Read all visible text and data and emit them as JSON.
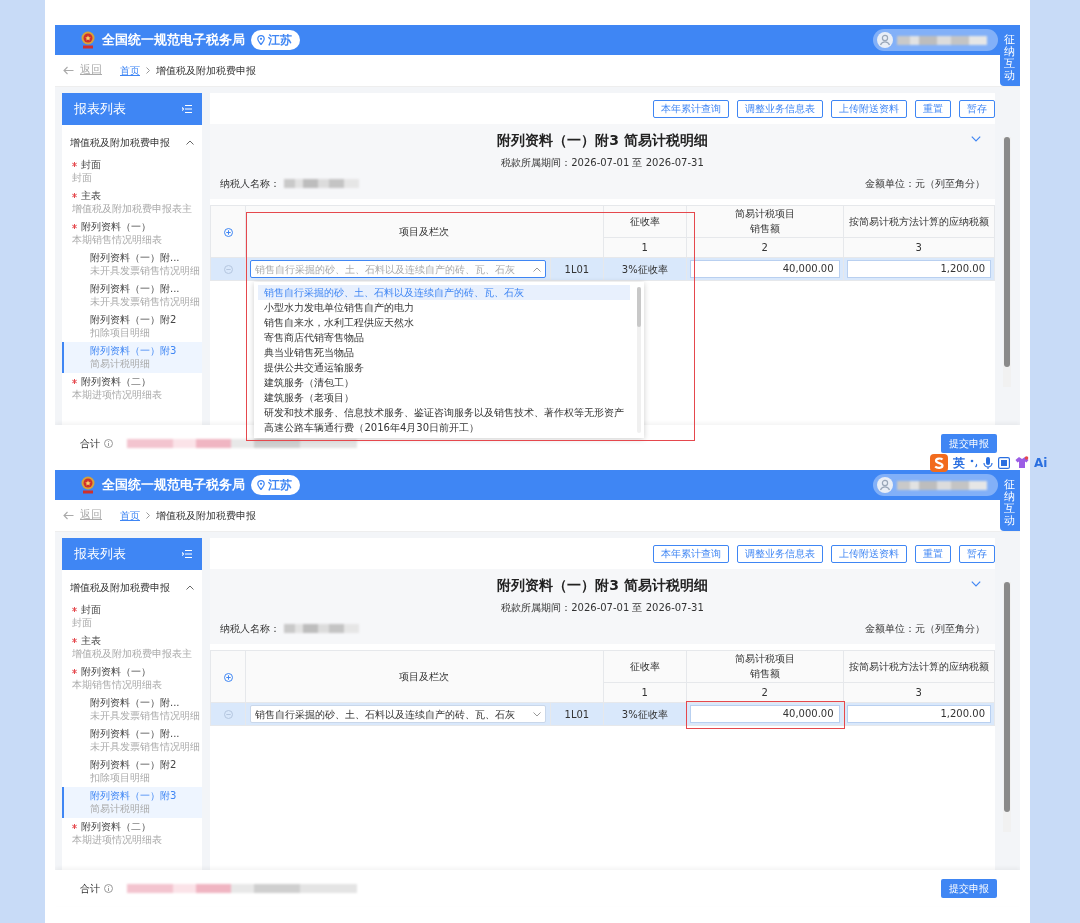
{
  "screens": [
    {
      "header": {
        "title": "全国统一规范电子税务局",
        "region": "江苏"
      },
      "side_tab": "征纳互动",
      "breadcrumb": {
        "back": "返回",
        "home": "首页",
        "current": "增值税及附加税费申报"
      },
      "sidebar": {
        "title": "报表列表",
        "group": {
          "label": "增值税及附加税费申报",
          "expanded": true,
          "items": [
            {
              "title": "封面",
              "subtitle": "封面",
              "required": true,
              "selected": false
            },
            {
              "title": "主表",
              "subtitle": "增值税及附加税费申报表主",
              "required": true,
              "selected": false
            },
            {
              "title": "附列资料（一）",
              "subtitle": "本期销售情况明细表",
              "required": true,
              "selected": false,
              "children": [
                {
                  "title": "附列资料（一）附...",
                  "subtitle": "未开具发票销售情况明细",
                  "required": false,
                  "selected": false
                },
                {
                  "title": "附列资料（一）附...",
                  "subtitle": "未开具发票销售情况明细",
                  "required": false,
                  "selected": false
                },
                {
                  "title": "附列资料（一）附2",
                  "subtitle": "扣除项目明细",
                  "required": false,
                  "selected": false
                },
                {
                  "title": "附列资料（一）附3",
                  "subtitle": "简易计税明细",
                  "required": false,
                  "selected": true
                }
              ]
            },
            {
              "title": "附列资料（二）",
              "subtitle": "本期进项情况明细表",
              "required": true,
              "selected": false
            }
          ]
        }
      },
      "toolbar": [
        "本年累计查询",
        "调整业务信息表",
        "上传附送资料",
        "重置",
        "暂存"
      ],
      "form": {
        "title": "附列资料（一）附3 简易计税明细",
        "period": "税款所属期间：2026-07-01 至 2026-07-31",
        "taxpayer_label": "纳税人名称：",
        "unit": "金额单位：元（列至角分）"
      },
      "table": {
        "columns": [
          {
            "label_lines": [
              "项目及栏次"
            ]
          },
          {
            "label_lines": [
              "征收率"
            ],
            "number": "1"
          },
          {
            "label_lines": [
              "简易计税项目",
              "销售额"
            ],
            "number": "2"
          },
          {
            "label_lines": [
              "按简易计税方法计算的应纳税额"
            ],
            "number": "3"
          }
        ],
        "rows": [
          {
            "item": {
              "placeholder": "销售自行采掘的砂、土、石料以及连续自产的砖、瓦、石灰",
              "expanded": true,
              "highlighted": true,
              "options": [
                {
                  "label": "销售自行采掘的砂、土、石料以及连续自产的砖、瓦、石灰",
                  "selected": true
                },
                {
                  "label": "小型水力发电单位销售自产的电力",
                  "selected": false
                },
                {
                  "label": "销售自来水，水利工程供应天然水",
                  "selected": false
                },
                {
                  "label": "寄售商店代销寄售物品",
                  "selected": false
                },
                {
                  "label": "典当业销售死当物品",
                  "selected": false
                },
                {
                  "label": "提供公共交通运输服务",
                  "selected": false
                },
                {
                  "label": "建筑服务（清包工）",
                  "selected": false
                },
                {
                  "label": "建筑服务（老项目）",
                  "selected": false
                },
                {
                  "label": "研发和技术服务、信息技术服务、鉴证咨询服务以及销售技术、著作权等无形资产",
                  "selected": false
                },
                {
                  "label": "高速公路车辆通行费（2016年4月30日前开工）",
                  "selected": false
                }
              ]
            },
            "code": "1L01",
            "rate": "3%征收率",
            "sales": {
              "value": "40,000.00",
              "highlighted": false
            },
            "tax": "1,200.00"
          }
        ]
      },
      "footer": {
        "total_label": "合计",
        "submit": "提交申报"
      },
      "ime_toolbar": {
        "language": "英",
        "assistant": "Ai"
      }
    },
    {
      "header": {
        "title": "全国统一规范电子税务局",
        "region": "江苏"
      },
      "side_tab": "征纳互动",
      "breadcrumb": {
        "back": "返回",
        "home": "首页",
        "current": "增值税及附加税费申报"
      },
      "sidebar": {
        "title": "报表列表",
        "group": {
          "label": "增值税及附加税费申报",
          "expanded": true,
          "items": [
            {
              "title": "封面",
              "subtitle": "封面",
              "required": true,
              "selected": false
            },
            {
              "title": "主表",
              "subtitle": "增值税及附加税费申报表主",
              "required": true,
              "selected": false
            },
            {
              "title": "附列资料（一）",
              "subtitle": "本期销售情况明细表",
              "required": true,
              "selected": false,
              "children": [
                {
                  "title": "附列资料（一）附...",
                  "subtitle": "未开具发票销售情况明细",
                  "required": false,
                  "selected": false
                },
                {
                  "title": "附列资料（一）附...",
                  "subtitle": "未开具发票销售情况明细",
                  "required": false,
                  "selected": false
                },
                {
                  "title": "附列资料（一）附2",
                  "subtitle": "扣除项目明细",
                  "required": false,
                  "selected": false
                },
                {
                  "title": "附列资料（一）附3",
                  "subtitle": "简易计税明细",
                  "required": false,
                  "selected": true
                }
              ]
            },
            {
              "title": "附列资料（二）",
              "subtitle": "本期进项情况明细表",
              "required": true,
              "selected": false
            }
          ]
        }
      },
      "toolbar": [
        "本年累计查询",
        "调整业务信息表",
        "上传附送资料",
        "重置",
        "暂存"
      ],
      "form": {
        "title": "附列资料（一）附3 简易计税明细",
        "period": "税款所属期间：2026-07-01 至 2026-07-31",
        "taxpayer_label": "纳税人名称：",
        "unit": "金额单位：元（列至角分）"
      },
      "table": {
        "columns": [
          {
            "label_lines": [
              "项目及栏次"
            ]
          },
          {
            "label_lines": [
              "征收率"
            ],
            "number": "1"
          },
          {
            "label_lines": [
              "简易计税项目",
              "销售额"
            ],
            "number": "2"
          },
          {
            "label_lines": [
              "按简易计税方法计算的应纳税额"
            ],
            "number": "3"
          }
        ],
        "rows": [
          {
            "item": {
              "value": "销售自行采掘的砂、土、石料以及连续自产的砖、瓦、石灰",
              "expanded": false,
              "highlighted": false
            },
            "code": "1L01",
            "rate": "3%征收率",
            "sales": {
              "value": "40,000.00",
              "highlighted": true
            },
            "tax": "1,200.00"
          }
        ]
      },
      "footer": {
        "total_label": "合计",
        "submit": "提交申报"
      }
    }
  ]
}
